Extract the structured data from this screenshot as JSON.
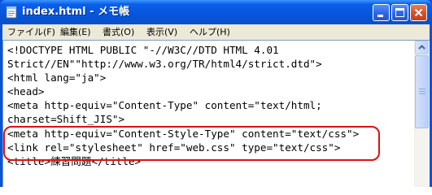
{
  "window": {
    "title": "index.html - メモ帳",
    "title_color": "#ffffff",
    "titlebar_color": "#0556dc",
    "buttons": {
      "minimize": "minimize-icon",
      "maximize": "maximize-icon",
      "close": "close-icon"
    }
  },
  "menu": {
    "items": [
      {
        "label": "ファイル(F)"
      },
      {
        "label": "編集(E)"
      },
      {
        "label": "書式(O)"
      },
      {
        "label": "表示(V)"
      },
      {
        "label": "ヘルプ(H)"
      }
    ]
  },
  "editor": {
    "lines": [
      "<!DOCTYPE HTML PUBLIC \"-//W3C//DTD HTML 4.01",
      "Strict//EN\"\"http://www.w3.org/TR/html4/strict.dtd\">",
      "<html lang=\"ja\">",
      "<head>",
      "<meta http-equiv=\"Content-Type\" content=\"text/html;",
      "charset=Shift_JIS\">",
      "<meta http-equiv=\"Content-Style-Type\" content=\"text/css\">",
      "<link rel=\"stylesheet\" href=\"web.css\" type=\"text/css\">",
      "<title>練習問題</title>"
    ],
    "highlight_color": "#e01010"
  }
}
